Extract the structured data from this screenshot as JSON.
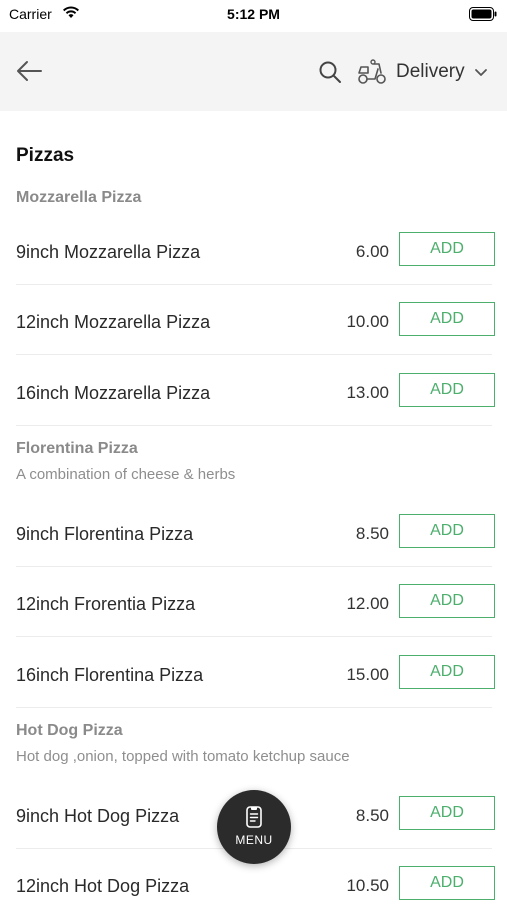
{
  "status_bar": {
    "carrier": "Carrier",
    "time": "5:12 PM"
  },
  "header": {
    "delivery_label": "Delivery"
  },
  "menu": {
    "section_title": "Pizzas",
    "groups": [
      {
        "name": "Mozzarella Pizza",
        "description": "",
        "items": [
          {
            "name": "9inch Mozzarella Pizza",
            "price": "6.00"
          },
          {
            "name": "12inch Mozzarella Pizza",
            "price": "10.00"
          },
          {
            "name": "16inch Mozzarella Pizza",
            "price": "13.00"
          }
        ]
      },
      {
        "name": "Florentina Pizza",
        "description": "A combination of cheese & herbs",
        "items": [
          {
            "name": "9inch Florentina Pizza",
            "price": "8.50"
          },
          {
            "name": "12inch Frorentia Pizza",
            "price": "12.00"
          },
          {
            "name": "16inch Florentina Pizza",
            "price": "15.00"
          }
        ]
      },
      {
        "name": "Hot Dog Pizza",
        "description": "Hot dog ,onion, topped with tomato ketchup sauce",
        "items": [
          {
            "name": "9inch Hot Dog Pizza",
            "price": "8.50"
          },
          {
            "name": "12inch Hot Dog Pizza",
            "price": "10.50"
          }
        ]
      }
    ],
    "add_label": "ADD"
  },
  "fab": {
    "label": "MENU"
  },
  "colors": {
    "accent": "#4caf6c",
    "header_bg": "#f4f4f4",
    "fab_bg": "#2b2b2b"
  },
  "icons": {
    "back": "arrow-left-icon",
    "search": "search-icon",
    "delivery": "scooter-icon",
    "dropdown": "chevron-down-icon",
    "menu": "menu-book-icon"
  }
}
